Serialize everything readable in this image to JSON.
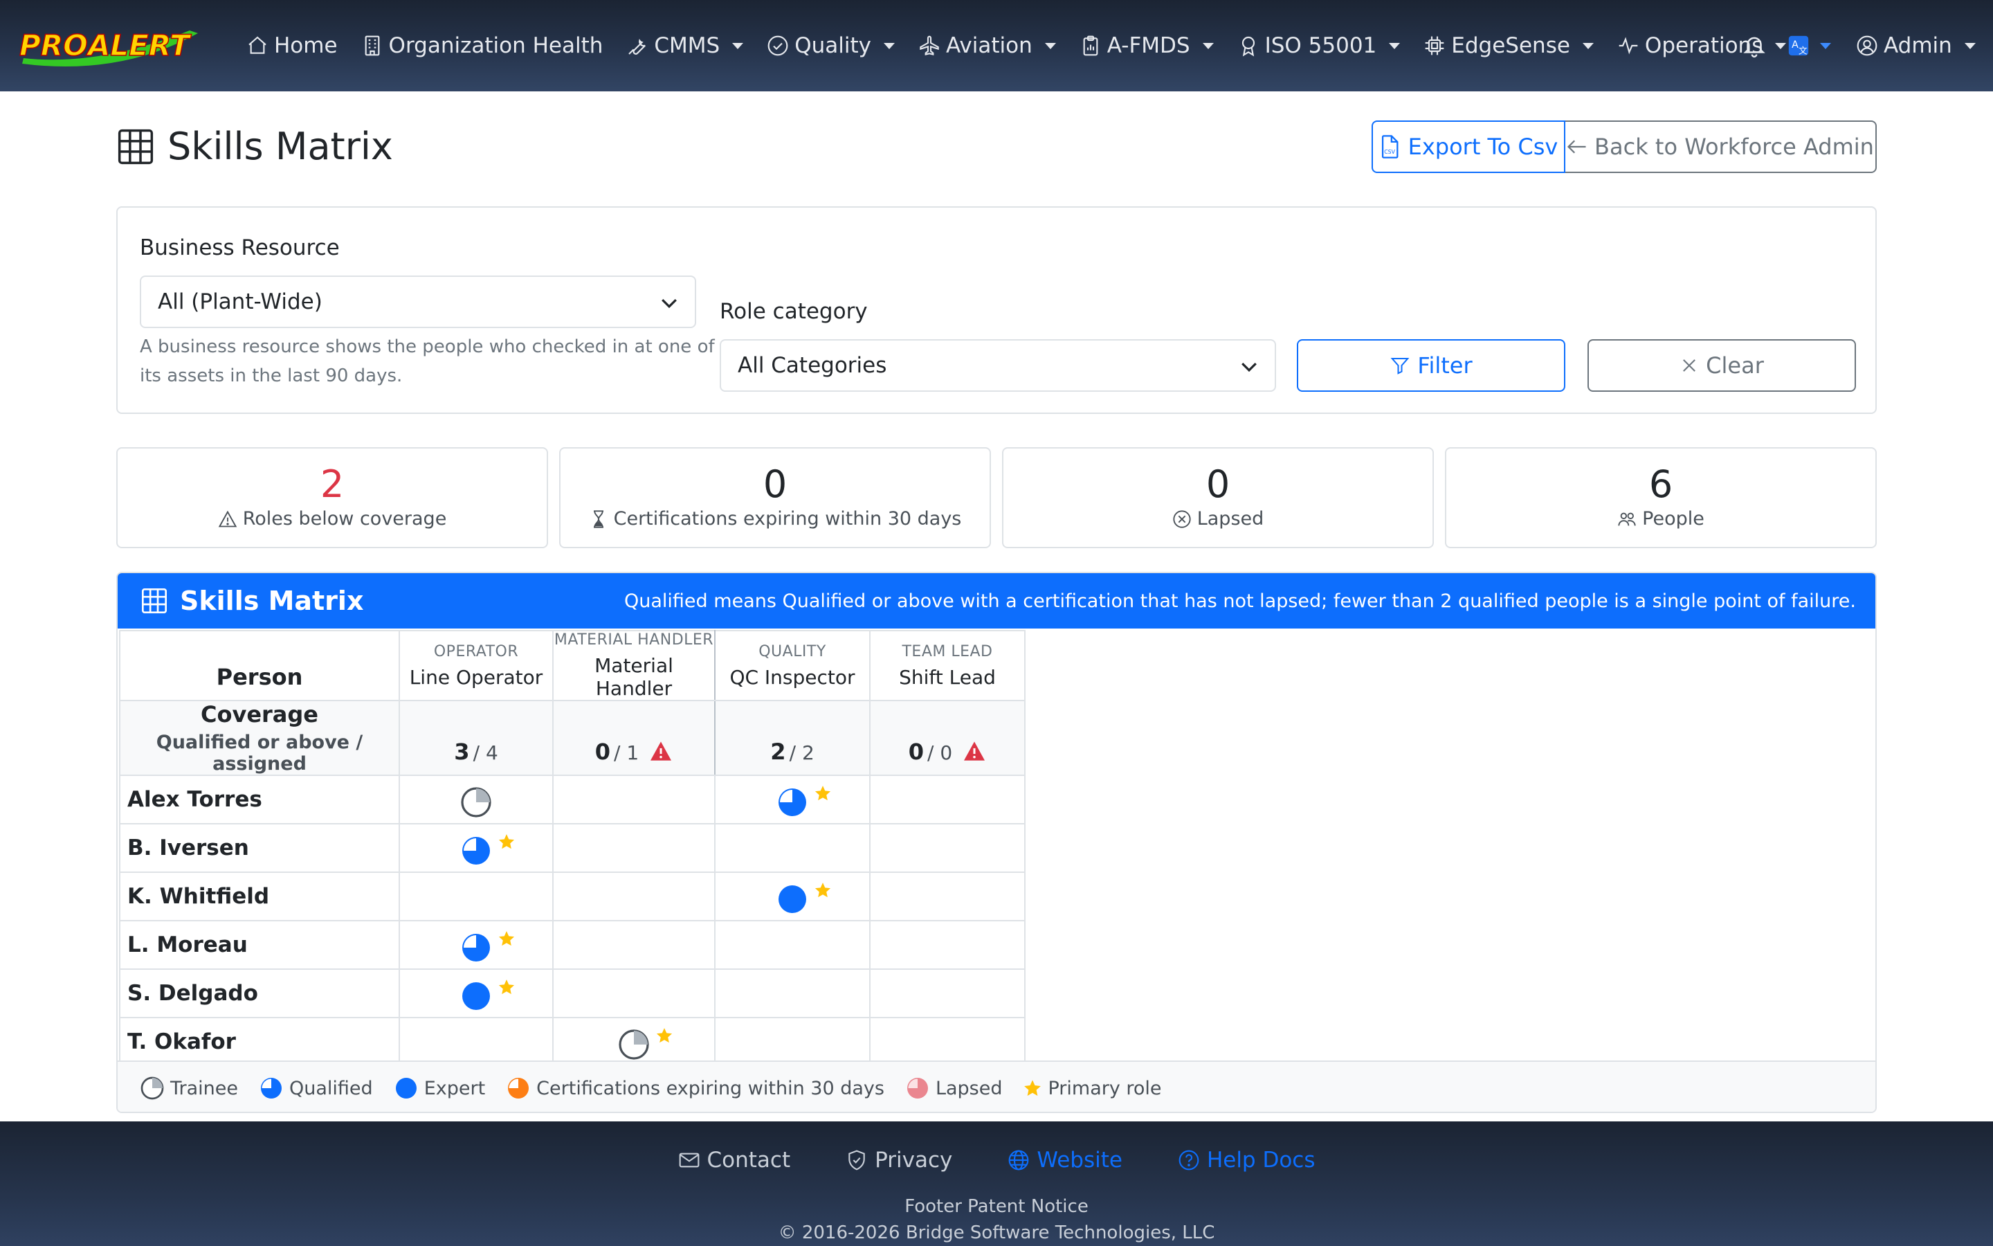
{
  "nav": {
    "brand_text": "PROALERT",
    "items": [
      {
        "label": "Home",
        "icon": "house-icon",
        "dropdown": false
      },
      {
        "label": "Organization Health",
        "icon": "building-icon",
        "dropdown": false
      },
      {
        "label": "CMMS",
        "icon": "wrench-icon",
        "dropdown": true
      },
      {
        "label": "Quality",
        "icon": "check-circle-icon",
        "dropdown": true
      },
      {
        "label": "Aviation",
        "icon": "airplane-icon",
        "dropdown": true
      },
      {
        "label": "A-FMDS",
        "icon": "clipboard-icon",
        "dropdown": true
      },
      {
        "label": "ISO 55001",
        "icon": "award-icon",
        "dropdown": true
      },
      {
        "label": "EdgeSense",
        "icon": "cpu-icon",
        "dropdown": true
      },
      {
        "label": "Operations",
        "icon": "activity-icon",
        "dropdown": true
      }
    ],
    "user_label": "Admin"
  },
  "page": {
    "title": "Skills Matrix",
    "export_label": "Export To Csv",
    "back_label": "Back to Workforce Admin"
  },
  "filters": {
    "business_resource_label": "Business Resource",
    "business_resource_value": "All (Plant-Wide)",
    "business_resource_help_1": "A business resource shows the people who checked in at one of",
    "business_resource_help_2": "its assets in the last 90 days.",
    "role_category_label": "Role category",
    "role_category_value": "All Categories",
    "filter_label": "Filter",
    "clear_label": "Clear"
  },
  "stats": [
    {
      "value": "2",
      "caption": "Roles below coverage",
      "icon": "warning-icon",
      "color": "#dc3545"
    },
    {
      "value": "0",
      "caption": "Certifications expiring within 30 days",
      "icon": "hourglass-icon",
      "color": "#212529"
    },
    {
      "value": "0",
      "caption": "Lapsed",
      "icon": "x-circle-icon",
      "color": "#212529"
    },
    {
      "value": "6",
      "caption": "People",
      "icon": "people-icon",
      "color": "#212529"
    }
  ],
  "matrix": {
    "title": "Skills Matrix",
    "note": "Qualified means Qualified or above with a certification that has not lapsed; fewer than 2 qualified people is a single point of failure.",
    "person_header": "Person",
    "coverage_label": "Coverage",
    "coverage_sub": "Qualified or above / assigned",
    "roles": [
      {
        "category": "OPERATOR",
        "name": "Line Operator",
        "qualified": "3",
        "assigned": "4",
        "alert": false
      },
      {
        "category": "MATERIAL HANDLER",
        "name": "Material Handler",
        "qualified": "0",
        "assigned": "1",
        "alert": true
      },
      {
        "category": "QUALITY",
        "name": "QC Inspector",
        "qualified": "2",
        "assigned": "2",
        "alert": false
      },
      {
        "category": "TEAM LEAD",
        "name": "Shift Lead",
        "qualified": "0",
        "assigned": "0",
        "alert": true
      }
    ],
    "people": [
      {
        "name": "Alex Torres",
        "skills": [
          {
            "level": "trainee",
            "primary": false
          },
          null,
          {
            "level": "qualified",
            "primary": true
          },
          null
        ]
      },
      {
        "name": "B. Iversen",
        "skills": [
          {
            "level": "qualified",
            "primary": true
          },
          null,
          null,
          null
        ]
      },
      {
        "name": "K. Whitfield",
        "skills": [
          null,
          null,
          {
            "level": "expert",
            "primary": true
          },
          null
        ]
      },
      {
        "name": "L. Moreau",
        "skills": [
          {
            "level": "qualified",
            "primary": true
          },
          null,
          null,
          null
        ]
      },
      {
        "name": "S. Delgado",
        "skills": [
          {
            "level": "expert",
            "primary": true
          },
          null,
          null,
          null
        ]
      },
      {
        "name": "T. Okafor",
        "skills": [
          null,
          {
            "level": "trainee",
            "primary": true
          },
          null,
          null
        ]
      }
    ]
  },
  "legend": {
    "trainee": "Trainee",
    "qualified": "Qualified",
    "expert": "Expert",
    "expiring": "Certifications expiring within 30 days",
    "lapsed": "Lapsed",
    "primary": "Primary role"
  },
  "colors": {
    "primary": "#0d6efd",
    "danger": "#dc3545",
    "warning": "#ffc107",
    "expiring": "#fd7e14",
    "lapsed": "#ea868f"
  },
  "footer": {
    "contact": "Contact",
    "privacy": "Privacy",
    "website": "Website",
    "help": "Help Docs",
    "notice": "Footer Patent Notice",
    "copyright": "© 2016-2026 Bridge Software Technologies, LLC"
  }
}
